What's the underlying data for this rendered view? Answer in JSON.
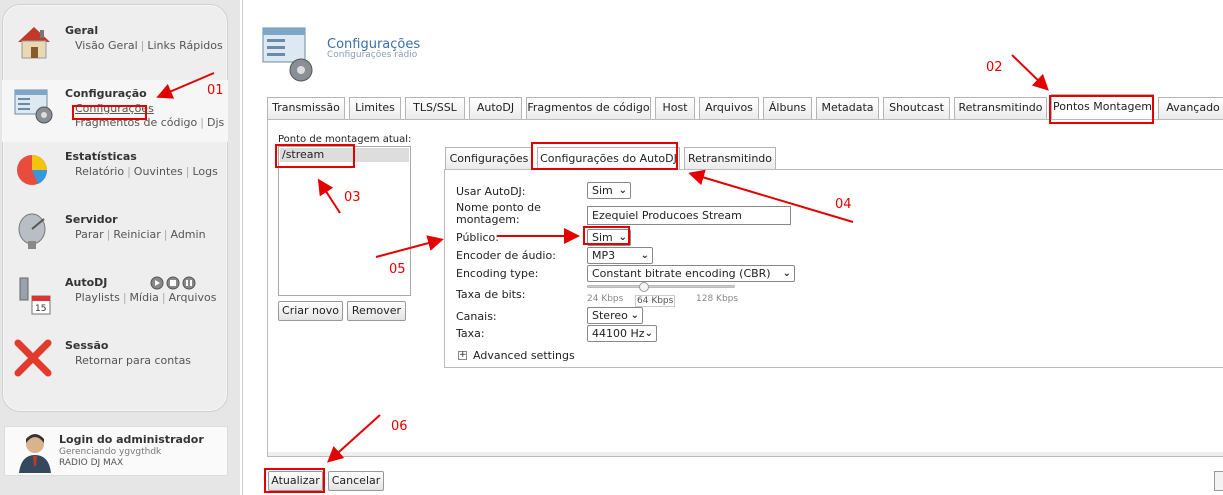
{
  "sidebar": {
    "items": [
      {
        "title": "Geral",
        "links": [
          "Visão Geral",
          "Links Rápidos"
        ]
      },
      {
        "title": "Configuração",
        "links": [
          "Configurações",
          "Fragmentos de código",
          "Djs"
        ]
      },
      {
        "title": "Estatísticas",
        "links": [
          "Relatório",
          "Ouvintes",
          "Logs"
        ]
      },
      {
        "title": "Servidor",
        "links": [
          "Parar",
          "Reiniciar",
          "Admin"
        ]
      },
      {
        "title": "AutoDJ",
        "links": [
          "Playlists",
          "Mídia",
          "Arquivos"
        ]
      },
      {
        "title": "Sessão",
        "links": [
          "Retornar para contas"
        ]
      }
    ],
    "admin": {
      "title": "Login do administrador",
      "managing": "Gerenciando ygvgthdk",
      "account": "RADIO DJ MAX"
    }
  },
  "header": {
    "title": "Configurações",
    "subtitle": "Configurações rádio"
  },
  "tabs": [
    "Transmissão",
    "Limites",
    "TLS/SSL",
    "AutoDJ",
    "Fragmentos de código",
    "Host",
    "Arquivos",
    "Álbuns",
    "Metadata",
    "Shoutcast",
    "Retransmitindo",
    "Pontos Montagem",
    "Avançado"
  ],
  "active_tab": "Pontos Montagem",
  "mount": {
    "label": "Ponto de montagem atual:",
    "items": [
      "/stream"
    ],
    "create_button": "Criar novo",
    "remove_button": "Remover"
  },
  "inner_tabs": [
    "Configurações",
    "Configurações do AutoDJ",
    "Retransmitindo"
  ],
  "active_inner_tab": "Configurações do AutoDJ",
  "form": {
    "use_autodj": {
      "label": "Usar AutoDJ:",
      "value": "Sim"
    },
    "mount_name": {
      "label": "Nome ponto de montagem:",
      "value": "Ezequiel Producoes Stream"
    },
    "public": {
      "label": "Público:",
      "value": "Sim"
    },
    "encoder": {
      "label": "Encoder de áudio:",
      "value": "MP3"
    },
    "encoding_type": {
      "label": "Encoding type:",
      "value": "Constant bitrate encoding (CBR)"
    },
    "bitrate": {
      "label": "Taxa de bits:",
      "min": "24 Kbps",
      "current": "64 Kbps",
      "max": "128 Kbps",
      "value_kbps": 64
    },
    "channels": {
      "label": "Canais:",
      "value": "Stereo"
    },
    "rate": {
      "label": "Taxa:",
      "value": "44100 Hz"
    },
    "advanced": "Advanced settings"
  },
  "buttons": {
    "update": "Atualizar",
    "cancel": "Cancelar"
  },
  "annotations": [
    "01",
    "02",
    "03",
    "04",
    "05",
    "06"
  ],
  "colors": {
    "annotation": "#e20000",
    "title": "#3a6fa3"
  }
}
